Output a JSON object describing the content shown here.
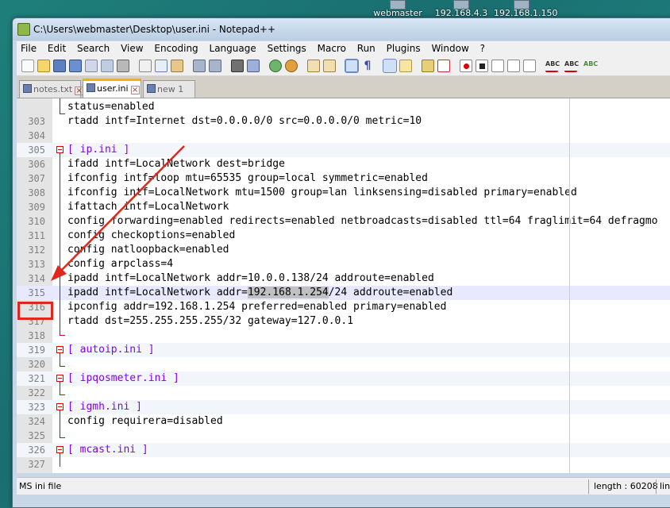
{
  "desktop": {
    "icons": [
      {
        "label": "webmaster"
      },
      {
        "label": "192.168.4.3"
      },
      {
        "label": "192.168.1.150"
      }
    ]
  },
  "window": {
    "title": "C:\\Users\\webmaster\\Desktop\\user.ini - Notepad++"
  },
  "menu": {
    "items": [
      "File",
      "Edit",
      "Search",
      "View",
      "Encoding",
      "Language",
      "Settings",
      "Macro",
      "Run",
      "Plugins",
      "Window",
      "?"
    ]
  },
  "toolbar": {
    "buttons": [
      "new-file",
      "open-file",
      "save",
      "save-all",
      "close",
      "close-all",
      "print",
      "cut",
      "copy",
      "paste",
      "undo",
      "redo",
      "find",
      "replace",
      "zoom-in",
      "zoom-out",
      "sync-vertical",
      "sync-horizontal",
      "word-wrap",
      "show-all-chars",
      "indent-guide",
      "user-defined-language",
      "doc-map",
      "function-list",
      "record-macro",
      "stop-recording",
      "play-macro",
      "run-macro-multiple",
      "save-macro",
      "spell-check",
      "spell-check-auto",
      "spell-next"
    ]
  },
  "tabs": [
    {
      "label": "notes.txt",
      "active": false
    },
    {
      "label": "user.ini",
      "active": true
    },
    {
      "label": "new  1",
      "active": false
    }
  ],
  "editor": {
    "lines": [
      {
        "num": "",
        "text": "status=enabled",
        "kind": "body"
      },
      {
        "num": "303",
        "text": "rtadd intf=Internet dst=0.0.0.0/0 src=0.0.0.0/0 metric=10",
        "kind": "body"
      },
      {
        "num": "304",
        "text": "",
        "kind": "blank"
      },
      {
        "num": "305",
        "text": "[ ip.ini ]",
        "kind": "section"
      },
      {
        "num": "306",
        "text": "ifadd intf=LocalNetwork dest=bridge",
        "kind": "body"
      },
      {
        "num": "307",
        "text": "ifconfig intf=loop mtu=65535 group=local symmetric=enabled",
        "kind": "body"
      },
      {
        "num": "308",
        "text": "ifconfig intf=LocalNetwork mtu=1500 group=lan linksensing=disabled primary=enabled",
        "kind": "body"
      },
      {
        "num": "309",
        "text": "ifattach intf=LocalNetwork",
        "kind": "body"
      },
      {
        "num": "310",
        "text": "config forwarding=enabled redirects=enabled netbroadcasts=disabled ttl=64 fraglimit=64 defragmo",
        "kind": "body"
      },
      {
        "num": "311",
        "text": "config checkoptions=enabled",
        "kind": "body"
      },
      {
        "num": "312",
        "text": "config natloopback=enabled",
        "kind": "body"
      },
      {
        "num": "313",
        "text": "config arpclass=4",
        "kind": "body"
      },
      {
        "num": "314",
        "text": "ipadd intf=LocalNetwork addr=10.0.0.138/24 addroute=enabled",
        "kind": "body"
      },
      {
        "num": "315",
        "text_before": "ipadd intf=LocalNetwork addr=",
        "text_selected": "192.168.1.254",
        "text_after": "/24 addroute=enabled",
        "kind": "current"
      },
      {
        "num": "316",
        "text": "ipconfig addr=192.168.1.254 preferred=enabled primary=enabled",
        "kind": "body"
      },
      {
        "num": "317",
        "text": "rtadd dst=255.255.255.255/32 gateway=127.0.0.1",
        "kind": "body-end"
      },
      {
        "num": "318",
        "text": "",
        "kind": "blank"
      },
      {
        "num": "319",
        "text": "[ autoip.ini ]",
        "kind": "section"
      },
      {
        "num": "320",
        "text": "",
        "kind": "blank"
      },
      {
        "num": "321",
        "text": "[ ipqosmeter.ini ]",
        "kind": "section"
      },
      {
        "num": "322",
        "text": "",
        "kind": "blank"
      },
      {
        "num": "323",
        "text": "[ igmh.ini ]",
        "kind": "section"
      },
      {
        "num": "324",
        "text": "config requirera=disabled",
        "kind": "body"
      },
      {
        "num": "325",
        "text": "",
        "kind": "blank"
      },
      {
        "num": "326",
        "text": "[ mcast.ini ]",
        "kind": "section"
      },
      {
        "num": "327",
        "text": "",
        "kind": "blank"
      }
    ]
  },
  "statusbar": {
    "language": "MS ini file",
    "length": "length : 60208",
    "lines_prefix": "lin"
  },
  "annotation": {
    "color": "#e0271f"
  }
}
